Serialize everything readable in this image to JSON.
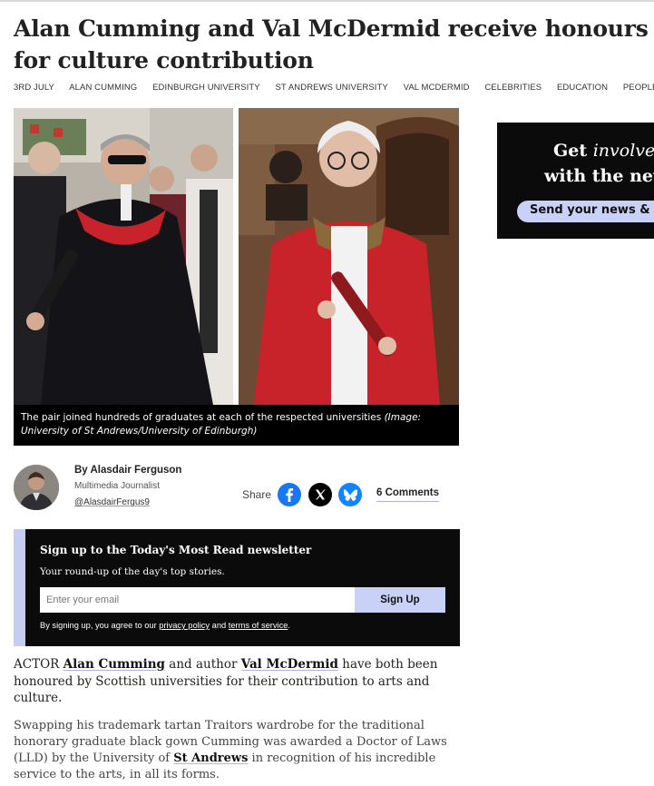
{
  "article": {
    "headline": "Alan Cumming and Val McDermid receive honours for culture contribution",
    "tags": [
      "3RD JULY",
      "ALAN CUMMING",
      "EDINBURGH UNIVERSITY",
      "ST ANDREWS UNIVERSITY",
      "VAL MCDERMID",
      "CELEBRITIES",
      "EDUCATION",
      "PEOPLE"
    ],
    "image_caption": "The pair joined hundreds of graduates at each of the respected universities",
    "image_credit": "(Image: University of St Andrews/University of Edinburgh)",
    "byline": {
      "name": "By Alasdair Ferguson",
      "role": "Multimedia Journalist",
      "handle": "@AlasdairFergus9"
    },
    "share": {
      "label": "Share",
      "icons": [
        "facebook-icon",
        "x-icon",
        "bluesky-icon"
      ],
      "comments": "6 Comments"
    },
    "body": {
      "p1": {
        "t1": "ACTOR ",
        "link1": "Alan Cumming",
        "t2": " and author ",
        "link2": "Val McDermid",
        "t3": " have both been honoured by Scottish universities for their contribution to arts and culture."
      },
      "p2": {
        "t1": "Swapping his trademark tartan Traitors wardrobe for the traditional honorary graduate black gown Cumming was awarded a Doctor of Laws (LLD) by the University of ",
        "link1": "St Andrews",
        "t2": " in recognition of his incredible service to the arts, in all its forms."
      }
    }
  },
  "newsletter": {
    "title": "Sign up to the Today's Most Read newsletter",
    "description": "Your round-up of the day's top stories.",
    "email_placeholder": "Enter your email",
    "button": "Sign Up",
    "legal_prefix": "By signing up, you agree to our ",
    "privacy_link": "privacy policy",
    "legal_and": " and ",
    "terms_link": "terms of service",
    "legal_suffix": "."
  },
  "ad": {
    "line1_bold": "Get ",
    "line1_italic": "involve",
    "line2": "with the new",
    "cta": "Send your news & p"
  },
  "colors": {
    "accent_lavender": "#c9d2f6",
    "dark_panel": "#0b0b0b",
    "text": "#222222"
  }
}
